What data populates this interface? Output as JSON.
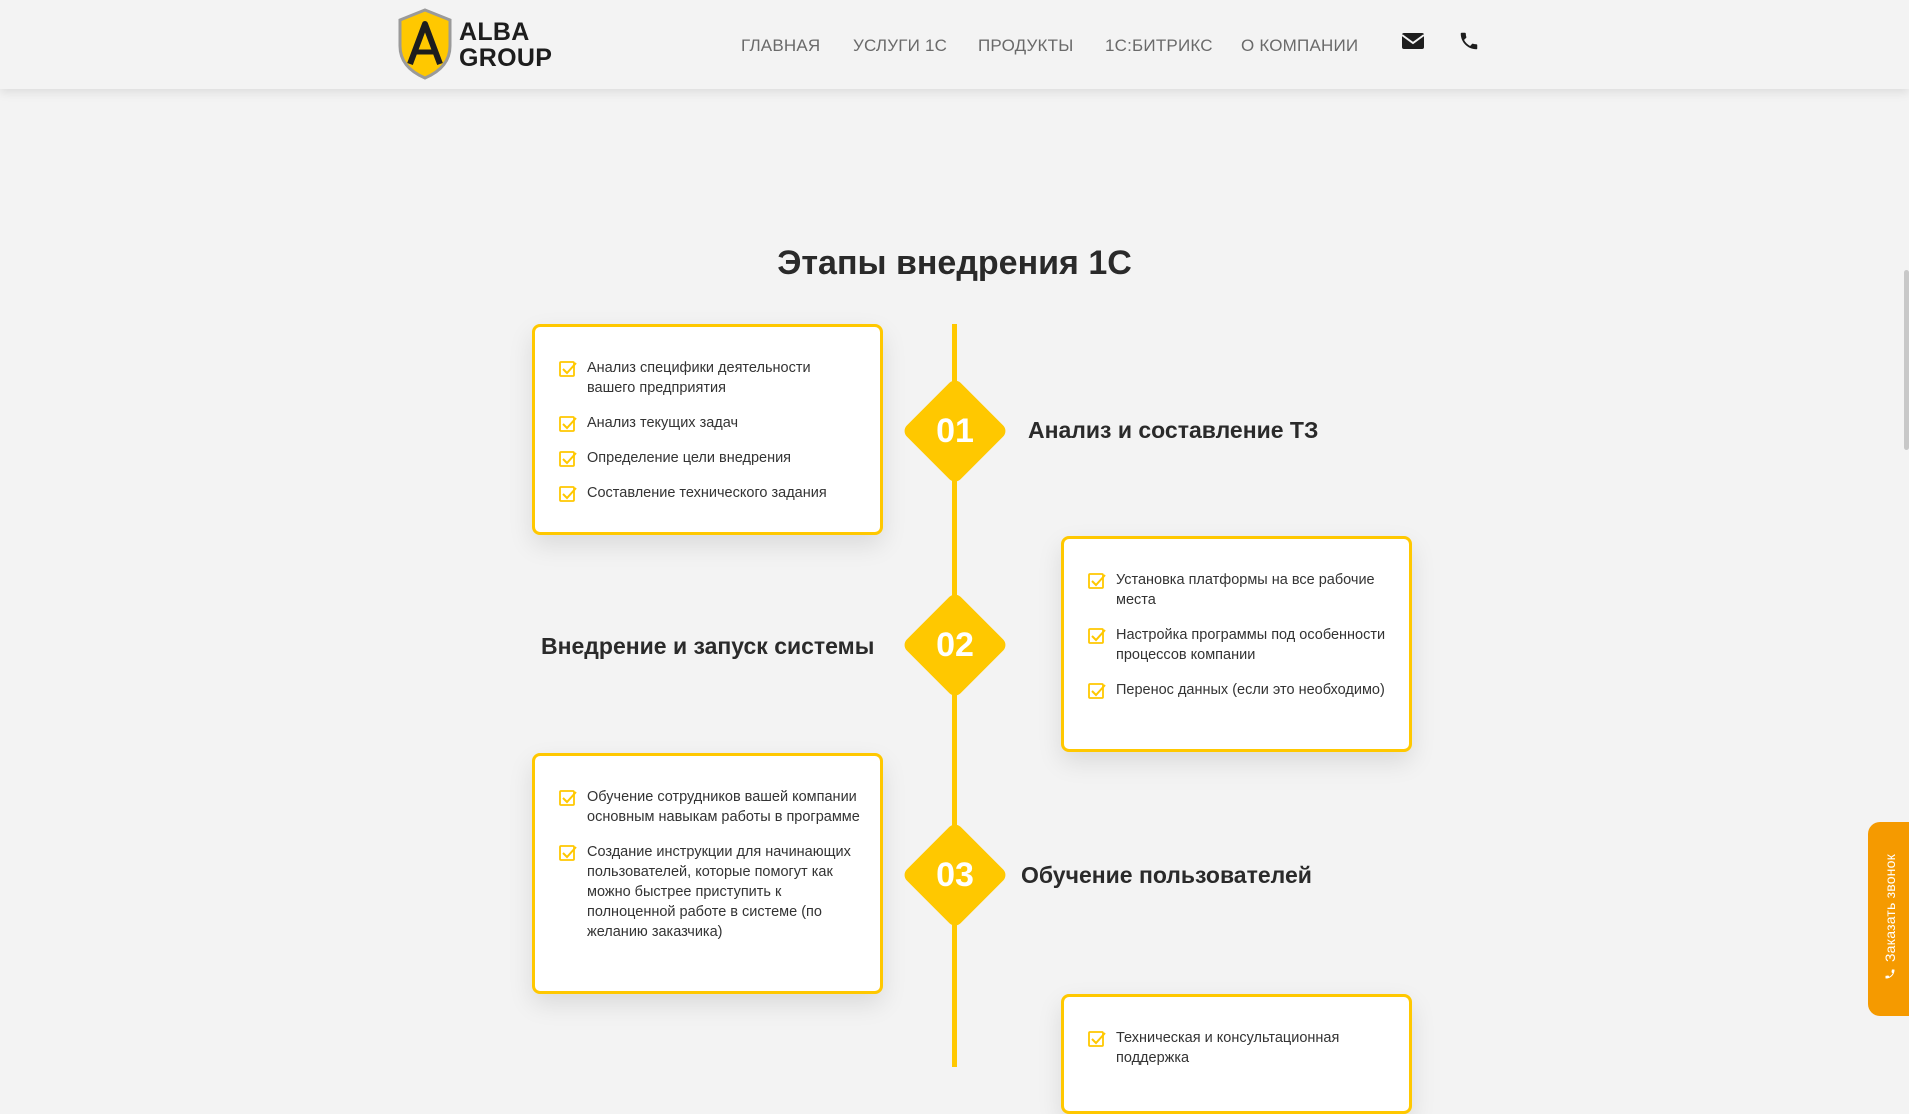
{
  "brand": {
    "line1": "ALBA",
    "line2": "GROUP",
    "accent": "#ffc800"
  },
  "nav": [
    {
      "label": "ГЛАВНАЯ"
    },
    {
      "label": "УСЛУГИ 1С"
    },
    {
      "label": "ПРОДУКТЫ"
    },
    {
      "label": "1С:БИТРИКС"
    },
    {
      "label": "О КОМПАНИИ"
    }
  ],
  "header_icons": [
    "envelope-icon",
    "phone-icon"
  ],
  "page_title": "Этапы внедрения 1С",
  "stages": [
    {
      "number": "01",
      "title": "Анализ и составление ТЗ",
      "items": [
        "Анализ специфики деятельности вашего предприятия",
        "Анализ текущих задач",
        "Определение цели внедрения",
        "Составление технического задания"
      ]
    },
    {
      "number": "02",
      "title": "Внедрение и запуск системы",
      "items": [
        "Установка платформы на все рабочие места",
        "Настройка программы под особенности процессов компании",
        "Перенос данных (если это необходимо)"
      ]
    },
    {
      "number": "03",
      "title": "Обучение пользователей",
      "items": [
        "Обучение сотрудников вашей компании основным навыкам работы в программе",
        "Создание инструкции для начинающих пользователей, которые помогут как можно быстрее приступить к полноценной работе в системе (по желанию заказчика)"
      ]
    },
    {
      "items": [
        "Техническая и консультационная поддержка"
      ]
    }
  ],
  "callback_button": {
    "label": "Заказать звонок",
    "color": "#f59a00"
  }
}
